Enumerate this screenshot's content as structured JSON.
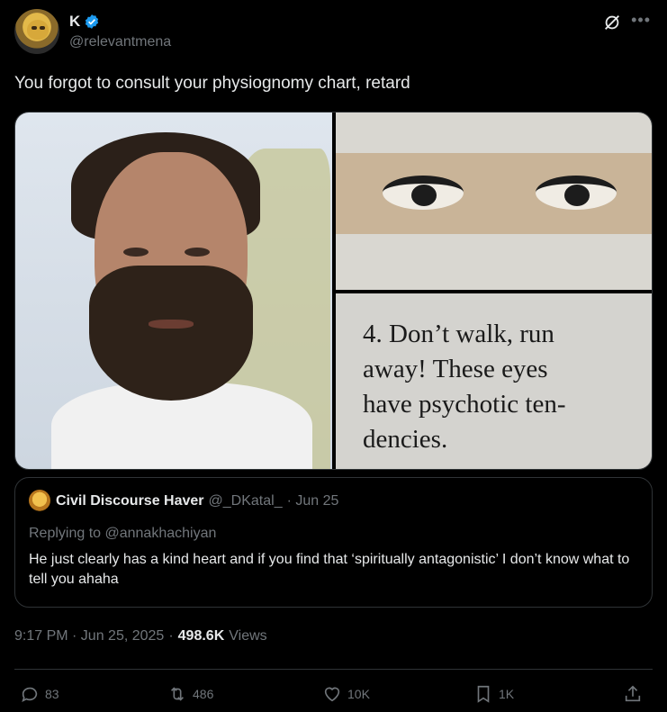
{
  "post": {
    "author": {
      "display_name": "K",
      "handle": "@relevantmena"
    },
    "text": "You forgot to consult your physiognomy chart, retard",
    "media_caption": "4. Don’t walk, run\naway! These eyes\nhave psychotic ten-\ndencies.",
    "timestamp": "9:17 PM · Jun 25, 2025",
    "views_count": "498.6K",
    "views_label": "Views"
  },
  "quote": {
    "display_name": "Civil Discourse Haver",
    "handle": "@_DKatal_",
    "date": "· Jun 25",
    "replying_to": "Replying to @annakhachiyan",
    "text": "He just clearly has a kind heart and if you find that ‘spiritually antagonistic’ I don’t know what to tell you ahaha"
  },
  "actions": {
    "replies": "83",
    "reposts": "486",
    "likes": "10K",
    "bookmarks": "1K"
  },
  "icons": [
    "verified-badge-icon",
    "grok-icon",
    "more-icon",
    "reply-icon",
    "repost-icon",
    "like-icon",
    "bookmark-icon",
    "share-icon"
  ],
  "colors": {
    "background": "#000000",
    "text": "#e7e9ea",
    "muted": "#71767b",
    "verified": "#1d9bf0",
    "border": "#2f3336"
  }
}
